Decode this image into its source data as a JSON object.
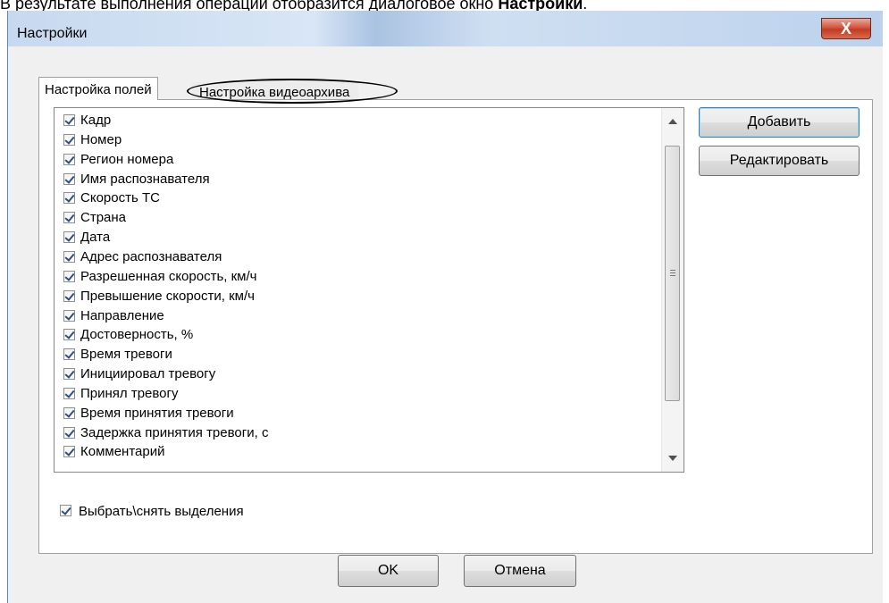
{
  "caption": {
    "text": "В результате выполнения операции отобразится диалоговое окно ",
    "bold": "Настройки",
    "end": "."
  },
  "window": {
    "title": "Настройки",
    "close_glyph": "X"
  },
  "tabs": [
    {
      "label": "Настройка полей",
      "active": true
    },
    {
      "label": "Настройка видеоархива",
      "active": false
    }
  ],
  "fields": [
    {
      "label": "Кадр",
      "checked": true
    },
    {
      "label": "Номер",
      "checked": true
    },
    {
      "label": "Регион номера",
      "checked": true
    },
    {
      "label": "Имя распознавателя",
      "checked": true
    },
    {
      "label": "Скорость ТС",
      "checked": true
    },
    {
      "label": "Страна",
      "checked": true
    },
    {
      "label": "Дата",
      "checked": true
    },
    {
      "label": "Адрес распознавателя",
      "checked": true
    },
    {
      "label": "Разрешенная скорость, км/ч",
      "checked": true
    },
    {
      "label": "Превышение скорости, км/ч",
      "checked": true
    },
    {
      "label": "Направление",
      "checked": true
    },
    {
      "label": "Достоверность, %",
      "checked": true
    },
    {
      "label": "Время тревоги",
      "checked": true
    },
    {
      "label": "Инициировал тревогу",
      "checked": true
    },
    {
      "label": "Принял тревогу",
      "checked": true
    },
    {
      "label": "Время принятия тревоги",
      "checked": true
    },
    {
      "label": "Задержка принятия тревоги, с",
      "checked": true
    },
    {
      "label": "Комментарий",
      "checked": true
    }
  ],
  "buttons": {
    "add": "Добавить",
    "edit": "Редактировать",
    "ok": "OK",
    "cancel": "Отмена"
  },
  "select_all": {
    "label": "Выбрать\\снять  выделения",
    "checked": true
  },
  "colors": {
    "title_bar": "#c7d9ef",
    "close_button": "#c23a22",
    "checkmark": "#2c4e87",
    "dialog_bg": "#f0f0f0"
  }
}
